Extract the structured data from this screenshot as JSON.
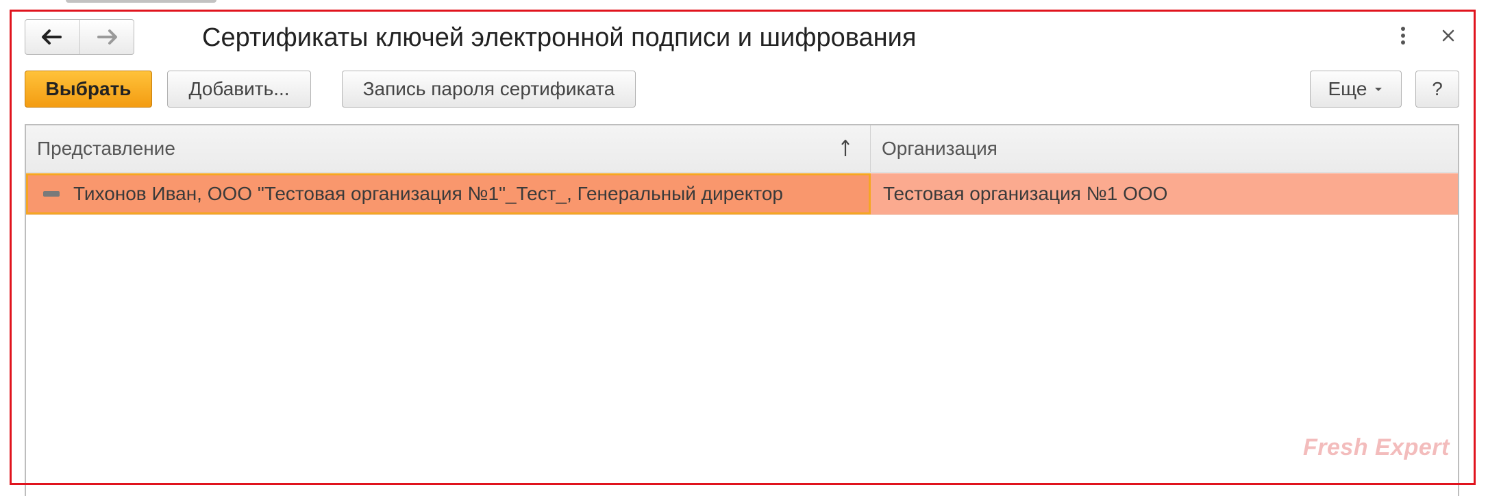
{
  "window": {
    "title": "Сертификаты ключей электронной подписи и шифрования",
    "more_icon": "vertical-ellipsis-icon",
    "close_icon": "close-icon"
  },
  "nav": {
    "back_icon": "arrow-left-icon",
    "forward_icon": "arrow-right-icon"
  },
  "toolbar": {
    "select_label": "Выбрать",
    "add_label": "Добавить...",
    "password_label": "Запись пароля сертификата",
    "more_label": "Еще",
    "help_label": "?"
  },
  "table": {
    "columns": [
      "Представление",
      "Организация"
    ],
    "sort": {
      "column": "Представление",
      "direction": "ascending",
      "icon": "sort-ascending-icon"
    },
    "rows": [
      {
        "presentation": "Тихонов Иван, ООО \"Тестовая организация №1\"_Тест_, Генеральный директор",
        "organization": "Тестовая организация №1 ООО",
        "icon": "certificate-icon",
        "selected": true
      }
    ]
  },
  "colors": {
    "primary_button": "#f5a623",
    "selected_row": "#fbaa8f",
    "selected_cell": "#f9976d",
    "frame": "#e0141e"
  },
  "watermark": "Fresh Expert"
}
